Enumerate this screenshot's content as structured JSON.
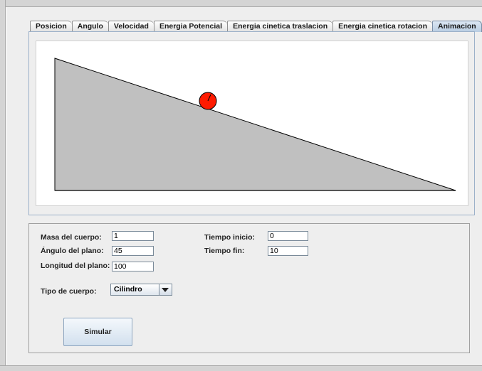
{
  "tabs": [
    {
      "label": "Posicion",
      "active": false
    },
    {
      "label": "Angulo",
      "active": false
    },
    {
      "label": "Velocidad",
      "active": false
    },
    {
      "label": "Energia Potencial",
      "active": false
    },
    {
      "label": "Energia cinetica traslacion",
      "active": false
    },
    {
      "label": "Energia cinetica rotacion",
      "active": false
    },
    {
      "label": "Animacion",
      "active": true
    }
  ],
  "animation": {
    "ramp_color": "#c0c0c0",
    "ball_color": "#ff1a00",
    "ball_outline": "#000000"
  },
  "form": {
    "masa": {
      "label": "Masa del cuerpo:",
      "value": "1"
    },
    "angulo": {
      "label": "Ángulo del plano:",
      "value": "45"
    },
    "longitud": {
      "label": "Longitud del plano:",
      "value": "100"
    },
    "tiempo_inicio": {
      "label": "Tiempo inicio:",
      "value": "0"
    },
    "tiempo_fin": {
      "label": "Tiempo fin:",
      "value": "10"
    },
    "tipo": {
      "label": "Tipo de cuerpo:",
      "selected": "Cilindro"
    },
    "simular_label": "Simular"
  }
}
